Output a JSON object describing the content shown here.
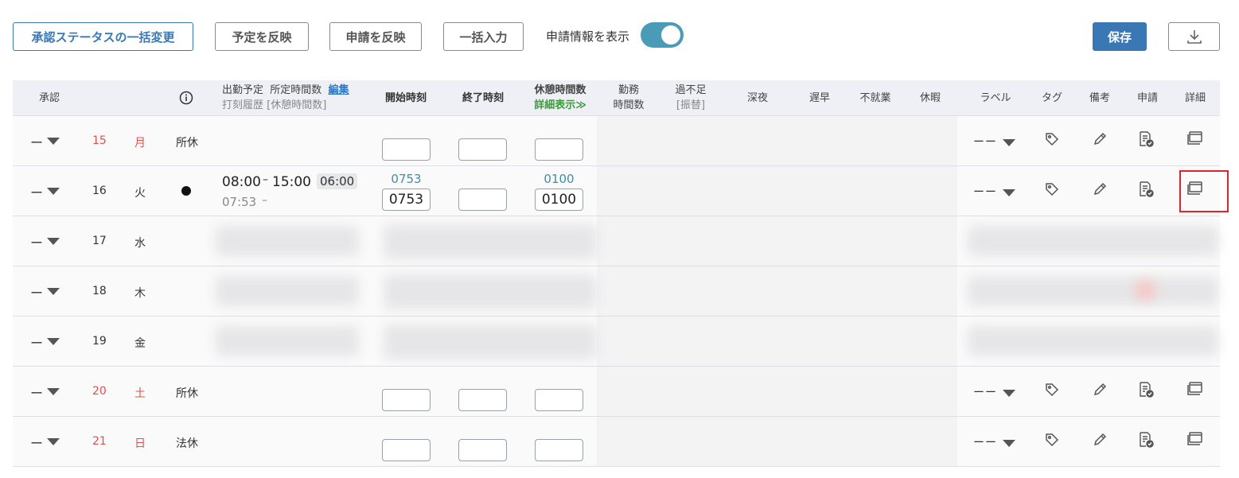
{
  "toolbar": {
    "bulk_status": "承認ステータスの一括変更",
    "apply_plan": "予定を反映",
    "apply_request": "申請を反映",
    "bulk_input": "一括入力",
    "show_request_label": "申請情報を表示",
    "show_request_on": true,
    "save": "保存"
  },
  "table": {
    "headers": {
      "approval": "承認",
      "plan_line1": "出勤予定",
      "plan_line1b": "所定時間数",
      "plan_edit": "編集",
      "plan_line2": "打刻履歴",
      "plan_line2b": "[休憩時間数]",
      "start": "開始時刻",
      "end": "終了時刻",
      "break": "休憩時間数",
      "break_detail": "詳細表示≫",
      "work1": "勤務",
      "work2": "時間数",
      "excess1": "過不足",
      "excess2": "[振替]",
      "night": "深夜",
      "late": "遅早",
      "absent": "不就業",
      "leave": "休暇",
      "label": "ラベル",
      "tag": "タグ",
      "note": "備考",
      "request": "申請",
      "detail": "詳細"
    },
    "rows": [
      {
        "approval": "ー",
        "day": "15",
        "weekday": "月",
        "holiday": true,
        "type": "所休"
      },
      {
        "approval": "ー",
        "day": "16",
        "weekday": "火",
        "holiday": false,
        "type": "",
        "plan_start": "08:00",
        "plan_sep": "–",
        "plan_end": "15:00",
        "plan_hours": "06:00",
        "stamp_start": "07:53",
        "stamp_sep": "–",
        "start_hint": "0753",
        "start_value": "0753",
        "break_hint": "0100",
        "break_value": "0100"
      },
      {
        "approval": "ー",
        "day": "17",
        "weekday": "水",
        "holiday": false,
        "blurred": true
      },
      {
        "approval": "ー",
        "day": "18",
        "weekday": "木",
        "holiday": false,
        "blurred": true
      },
      {
        "approval": "ー",
        "day": "19",
        "weekday": "金",
        "holiday": false,
        "blurred": true
      },
      {
        "approval": "ー",
        "day": "20",
        "weekday": "土",
        "holiday": true,
        "type": "所休"
      },
      {
        "approval": "ー",
        "day": "21",
        "weekday": "日",
        "holiday": true,
        "type": "法休"
      }
    ],
    "label_placeholder": "ーー"
  },
  "colors": {
    "accent": "#3a78b5",
    "toggle": "#4a9bb8",
    "holiday_red": "#e05050",
    "highlight": "#e0242a"
  }
}
